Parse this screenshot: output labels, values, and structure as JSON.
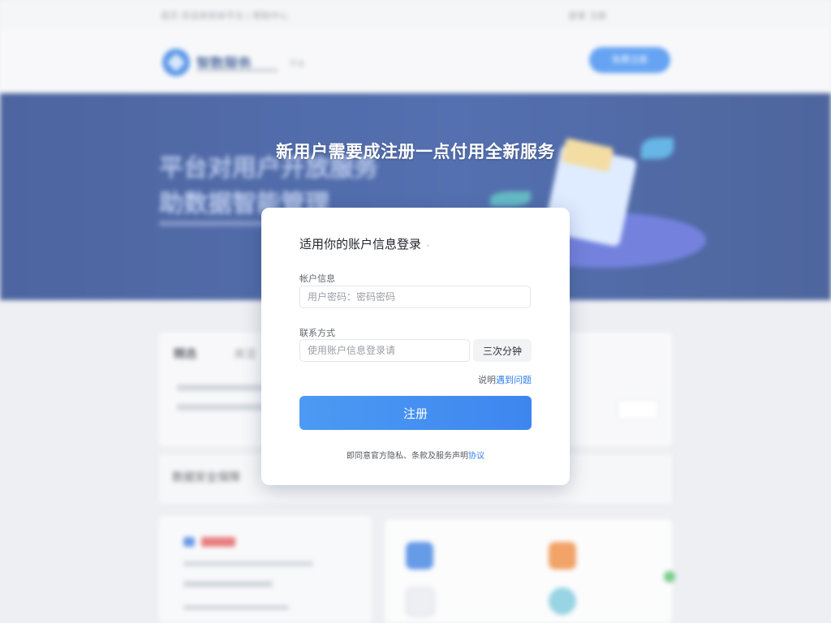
{
  "background": {
    "topbar": {
      "left_text": "首页  欢迎来到本平台  | 帮助中心",
      "right_text": "登录  注册"
    },
    "header": {
      "logo_text": "智数服务",
      "tag": "平台",
      "button": "免费注册"
    },
    "banner": {
      "title": "平台对用户开放服务\n助数据智能管理"
    },
    "tabs": [
      "精选",
      "关注"
    ],
    "section_title": "数据安全保障"
  },
  "modal": {
    "headline": "新用户需要成注册一点付用全新服务",
    "title": "适用你的账户信息登录",
    "account": {
      "label": "帐户信息",
      "placeholder": "用户密码：密码密码"
    },
    "contact": {
      "label": "联系方式",
      "placeholder": "使用账户信息登录请"
    },
    "code_button": "三次分钟",
    "help": {
      "prefix": "说明",
      "link": "遇到问题"
    },
    "submit_label": "注册",
    "agreement": {
      "text": "即同意官方隐私、条款及服务声明",
      "link": "协议"
    }
  },
  "colors": {
    "accent": "#3e86ef",
    "banner": "#24489a",
    "link": "#2f7fe8"
  }
}
